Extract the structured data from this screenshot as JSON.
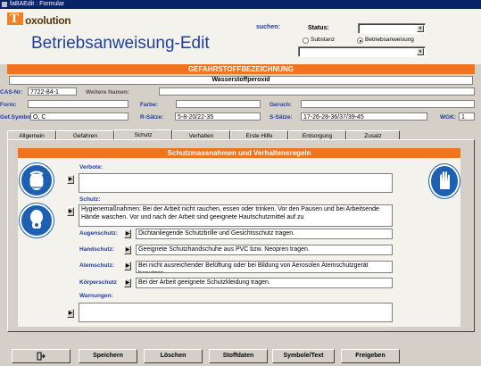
{
  "window": {
    "title": "faBAEdit : Formular"
  },
  "logo": {
    "letter": "T",
    "word": "oxolution"
  },
  "app": {
    "title": "Betriebsanweisung-Edit"
  },
  "search": {
    "label": "suchen:",
    "status_label": "Status:",
    "status_value": "",
    "radio_substanz": "Substanz",
    "radio_betrieb": "Betriebsanweisung",
    "selected": "Betriebsanweisung",
    "search_value": ""
  },
  "hazard": {
    "header": "GEFAHRSTOFFBEZEICHNUNG",
    "name": "Wasserstoffperoxid"
  },
  "fields": {
    "cas_label": "CAS-Nr:",
    "cas_value": "7722-84-1",
    "weitere_label": "Weitere Namen:",
    "weitere_value": "",
    "form_label": "Form:",
    "form_value": "",
    "farbe_label": "Farbe:",
    "farbe_value": "",
    "geruch_label": "Geruch:",
    "geruch_value": "",
    "gefsym_label": "Gef.Symbole:",
    "gefsym_value": "O, C",
    "rsatz_label": "R-Sätze:",
    "rsatz_value": "5-8-20/22-35",
    "ssatz_label": "S-Sätze:",
    "ssatz_value": "17-26-28-36/37/39-45",
    "wgk_label": "WGK:",
    "wgk_value": "1"
  },
  "tabs": [
    "Allgemein",
    "Gefahren",
    "Schutz",
    "Verhalten",
    "Erste Hilfe",
    "Entsorgung",
    "Zusatz"
  ],
  "active_tab": "Schutz",
  "section": {
    "header": "Schutzmassnahmen und Verhaltensregeln",
    "verbote_label": "Verbote:",
    "verbote_value": "",
    "schutz_label": "Schutz:",
    "schutz_value": "Hygienemaßnahmen: Bei der Arbeit nicht rauchen, essen oder trinken. Vor den Pausen und bei Arbeitsende Hände waschen. Vor und nach der Arbeit sind geeignete Hautschutzmittel auf zu",
    "augen_label": "Augenschutz:",
    "augen_value": "Dichtanliegende Schutzbrille und Gesichtsschutz tragen.",
    "hand_label": "Handschutz:",
    "hand_value": "Geeignete Schutzhandschuhe aus PVC  bzw. Neopren tragen.",
    "atem_label": "Atemschutz:",
    "atem_value": "Bei nicht ausreichender Belüftung oder bei Bildung von Aerosolen Atemschutzgerät benutzen.",
    "koerper_label": "Körperschutz",
    "koerper_value": "Bei der Arbeit geeignete Schutzkleidung tragen.",
    "warnungen_label": "Warnungen:",
    "warnungen_value": ""
  },
  "buttons": {
    "speichern": "Speichern",
    "loeschen": "Löschen",
    "stoffdaten": "Stoffdaten",
    "symbole": "Symbole/Text",
    "freigeben": "Freigeben"
  },
  "colors": {
    "accent": "#f07420",
    "title_blue": "#1f3f9a",
    "pictogram_blue": "#1d5fb0"
  },
  "icons": [
    "exit-icon",
    "face-shield-icon",
    "respirator-icon",
    "gloves-icon"
  ]
}
